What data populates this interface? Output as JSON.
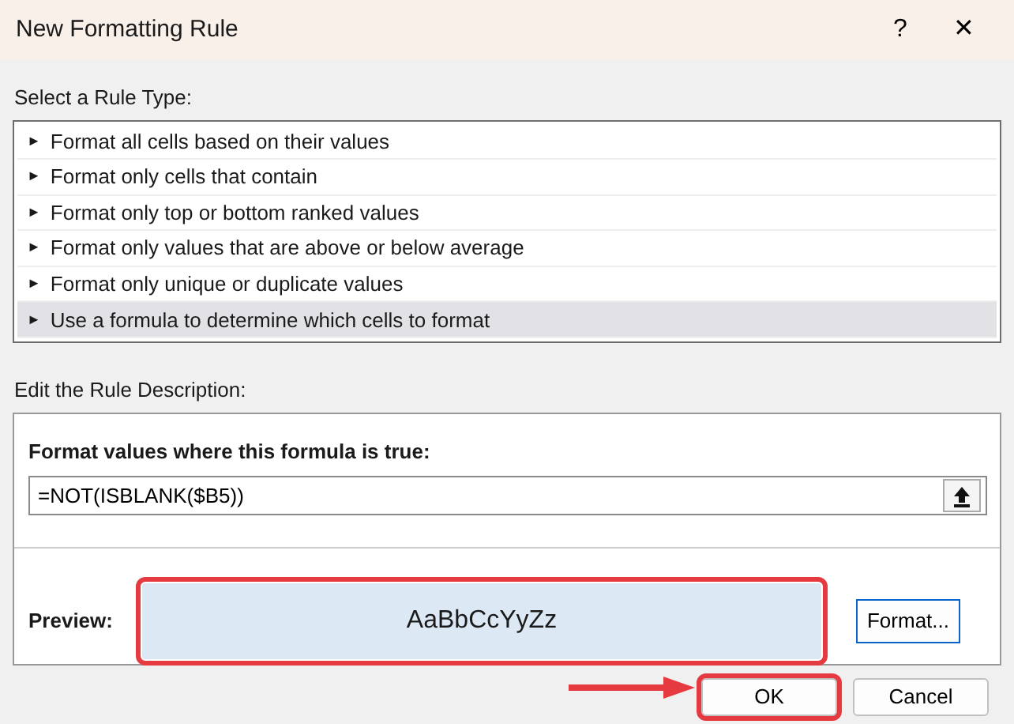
{
  "window": {
    "title": "New Formatting Rule",
    "help": "?",
    "close": "✕"
  },
  "rule_type": {
    "label": "Select a Rule Type:",
    "items": [
      {
        "marker": "►",
        "text": "Format all cells based on their values",
        "selected": false
      },
      {
        "marker": "►",
        "text": "Format only cells that contain",
        "selected": false
      },
      {
        "marker": "►",
        "text": "Format only top or bottom ranked values",
        "selected": false
      },
      {
        "marker": "►",
        "text": "Format only values that are above or below average",
        "selected": false
      },
      {
        "marker": "►",
        "text": "Format only unique or duplicate values",
        "selected": false
      },
      {
        "marker": "►",
        "text": "Use a formula to determine which cells to format",
        "selected": true
      }
    ]
  },
  "description": {
    "label": "Edit the Rule Description:",
    "formula_label": "Format values where this formula is true:",
    "formula_value": "=NOT(ISBLANK($B5))",
    "preview_label": "Preview:",
    "preview_text": "AaBbCcYyZz",
    "preview_highlighted": true,
    "format_button": "Format..."
  },
  "buttons": [
    {
      "label": "OK",
      "highlighted": true,
      "arrow": true
    },
    {
      "label": "Cancel",
      "highlighted": false,
      "arrow": false
    }
  ]
}
